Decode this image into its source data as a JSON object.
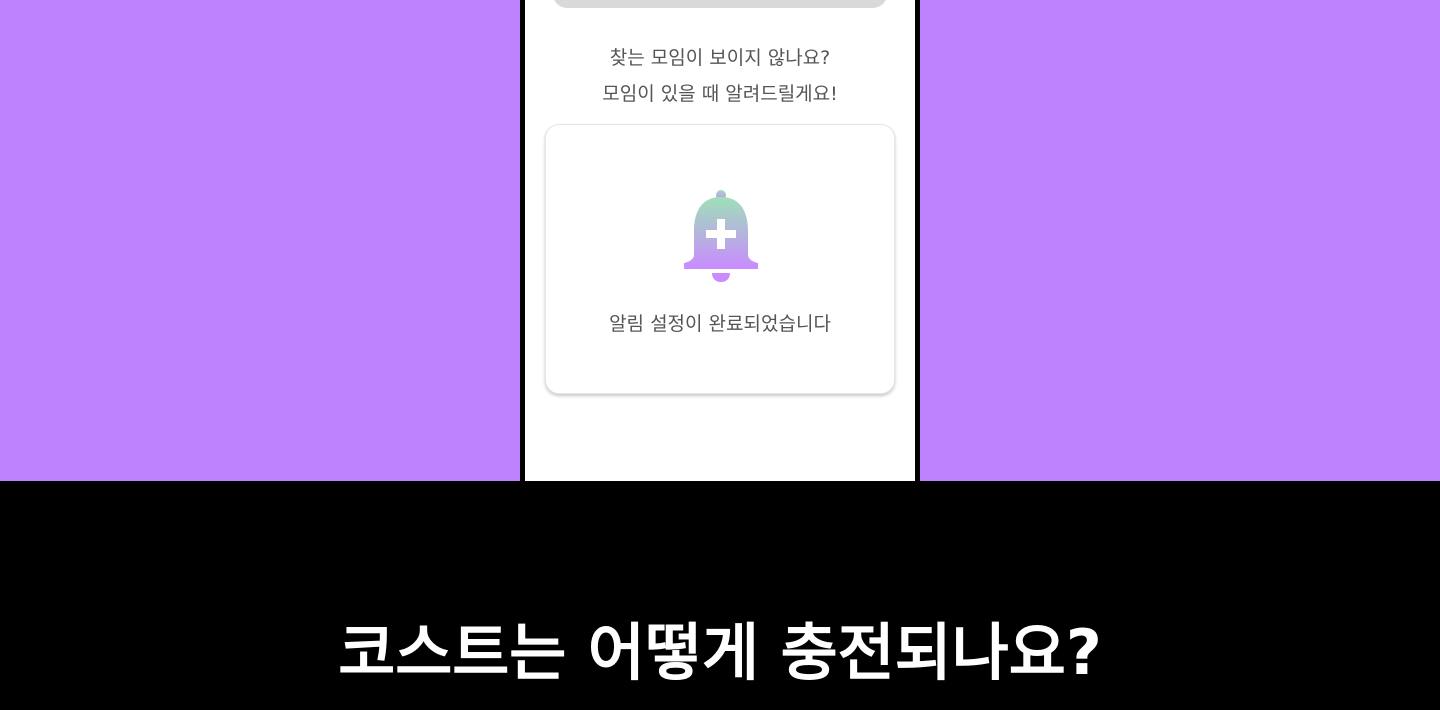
{
  "screen": {
    "message_line1": "찾는 모임이 보이지 않나요?",
    "message_line2": "모임이 있을 때 알려드릴게요!",
    "notify_card": {
      "icon": "bell-plus-icon",
      "label": "알림 설정이 완료되었습니다"
    }
  },
  "caption": "코스트는 어떻게 충전되나요?",
  "colors": {
    "background": "#bf82ff",
    "bell_gradient_top": "#9ee0b8",
    "bell_gradient_bottom": "#c98bff",
    "caption_bar": "#000000"
  }
}
